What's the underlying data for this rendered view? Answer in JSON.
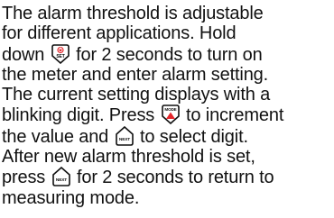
{
  "paragraph": {
    "l1": "The alarm threshold is adjustable",
    "l2": "for different applications. Hold",
    "l3a": "down",
    "l3b": "for 2 seconds to turn on",
    "l4": "the meter and enter alarm setting.",
    "l5": "The current setting displays with a",
    "l6a": "blinking digit. Press",
    "l6b": "to increment",
    "l7a": "the value and",
    "l7b": "to select digit.",
    "l8": "After new alarm threshold is set,",
    "l9a": "press",
    "l9b": "for 2 seconds to return to",
    "l10": "measuring mode."
  },
  "icons": {
    "power_set": {
      "name": "power-set-button-icon",
      "top_text": "⏻",
      "bottom_text": "SET",
      "accent": "#e3262b"
    },
    "mode": {
      "name": "mode-up-button-icon",
      "top_text": "MODE",
      "arrow": "▲",
      "accent": "#e3262b"
    },
    "next": {
      "name": "next-button-icon",
      "text": "NEXT"
    }
  }
}
